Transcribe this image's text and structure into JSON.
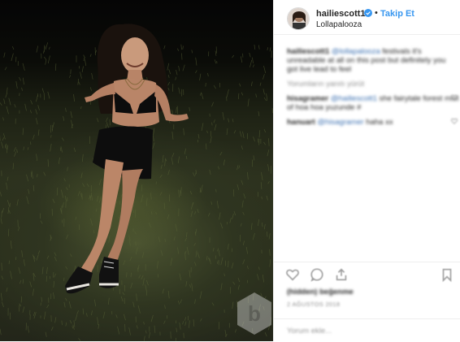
{
  "post": {
    "header": {
      "username": "hailiescott1",
      "follow_label": "Takip Et",
      "dot": "•",
      "location": "Lollapalooza"
    },
    "caption": {
      "username": "hailiescott1",
      "parts": [
        "",
        "@lollapalooza",
        " festivals it's",
        "unreadable at all on this post but definitely you",
        "got live lead to feel"
      ]
    },
    "comments": [
      {
        "text": "Yorumların yanıtı yürüt"
      },
      {
        "user": "hisagramer",
        "mention": "@hailiescott1",
        "text": " she fairytale forest mist",
        "line2": "of hoa hoa yuzunde #"
      },
      {
        "user": "hanuart",
        "mention": "@hisagramer",
        "text": " haha xx"
      }
    ],
    "likes": "(hidden) beğenme",
    "date": "2 AĞUSTOS 2018",
    "add_comment_placeholder": "Yorum ekle...",
    "colors": {
      "link": "#3897f0",
      "text": "#262626",
      "muted": "#8e8e8e",
      "border": "#efefef"
    },
    "icons": [
      "heart-icon",
      "comment-icon",
      "share-icon",
      "bookmark-icon",
      "verified-badge-icon",
      "watermark-logo"
    ]
  }
}
